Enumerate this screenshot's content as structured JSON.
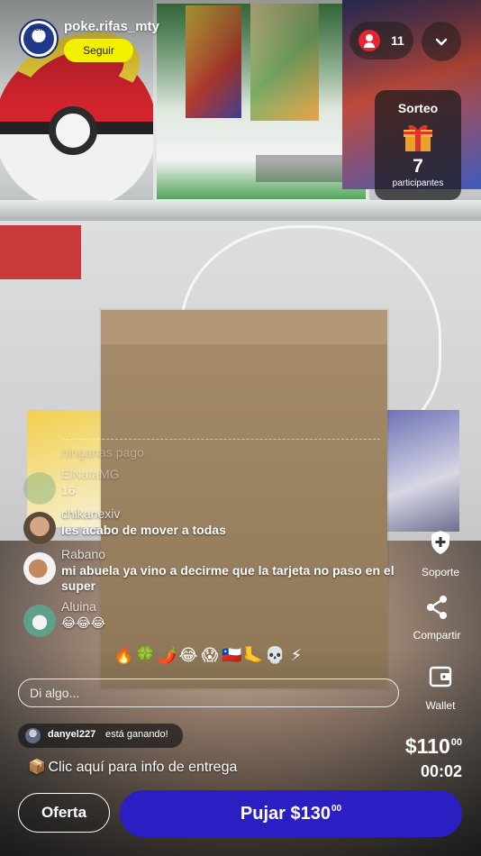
{
  "header": {
    "seller_name": "poke.rifas_mty",
    "seller_logo_text": "Poke",
    "follow_label": "Seguir",
    "viewer_count": "11"
  },
  "raffle": {
    "title": "Sorteo",
    "participants": "7",
    "participants_label": "participantes"
  },
  "chat": {
    "messages": [
      {
        "user": "",
        "text": "ninganas pago",
        "avatar_color": "#9a9a9a"
      },
      {
        "user": "ElNataMG",
        "text": "16",
        "avatar_color": "#7fb07f"
      },
      {
        "user": "chikanexiv",
        "text": "les acabo de mover a todas",
        "avatar_color": "#8a6a4a"
      },
      {
        "user": "Rabano",
        "text": "mi abuela ya vino a decirme que la tarjeta no paso en el super",
        "avatar_color": "#b0805a"
      },
      {
        "user": "Aluina",
        "text": "😂😂😂",
        "avatar_color": "#6a9a8a"
      }
    ],
    "input_placeholder": "Di algo..."
  },
  "reactions": [
    "🔥",
    "🍀",
    "🌶️",
    "😂",
    "😱",
    "🇨🇱",
    "🦶",
    "💀",
    "⚡"
  ],
  "side_actions": {
    "support_label": "Soporte",
    "share_label": "Compartir",
    "wallet_label": "Wallet"
  },
  "winner": {
    "name": "danyel227",
    "status": "está ganando!"
  },
  "delivery_text": "Clic aquí para info de entrega",
  "auction": {
    "price_main": "$110",
    "price_cents": "00",
    "timer": "00:02"
  },
  "actions": {
    "offer_label": "Oferta",
    "bid_label_main": "Pujar $130",
    "bid_label_cents": "00"
  },
  "colors": {
    "follow_bg": "#f2f000",
    "bid_bg": "#2b1ec2",
    "viewer_icon": "#e3262f"
  }
}
